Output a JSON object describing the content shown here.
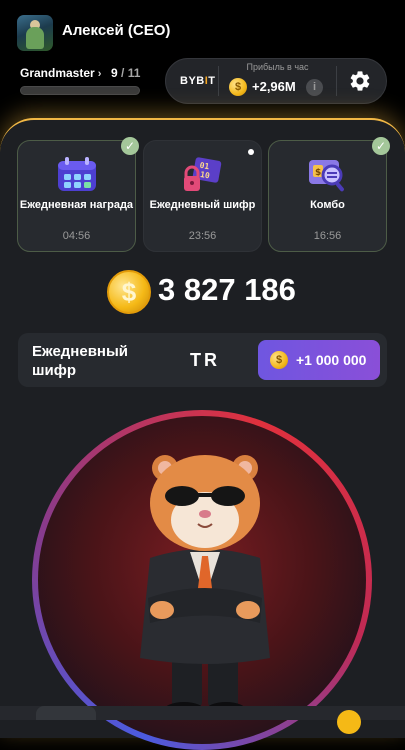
{
  "header": {
    "username": "Алексей (CEO)",
    "rank": "Grandmaster",
    "level_current": "9",
    "level_total": "/ 11",
    "level_progress": 0,
    "exchange": {
      "pre": "BYB",
      "mid": "I",
      "post": "T"
    },
    "profit_label": "Прибыль в час",
    "profit_value": "+2,96M",
    "info_icon": "i"
  },
  "daily_cards": [
    {
      "label": "Ежедневная награда",
      "time": "04:56",
      "completed": true,
      "icon": "calendar-icon"
    },
    {
      "label": "Ежедневный шифр",
      "time": "23:56",
      "completed": false,
      "icon": "cipher-lock-icon"
    },
    {
      "label": "Комбо",
      "time": "16:56",
      "completed": true,
      "icon": "combo-magnifier-icon"
    }
  ],
  "balance": {
    "coin_symbol": "$",
    "value": "3 827 186"
  },
  "cipher": {
    "label": "Ежедневный шифр",
    "code": "TR",
    "reward": "+1 000 000",
    "coin_symbol": "$"
  },
  "colors": {
    "accent_gold": "#f2b845",
    "purple_button": "#7a52de",
    "check_green": "#a4c79a"
  },
  "icons": [
    "settings-gear-icon",
    "info-icon",
    "coin-icon",
    "check-icon"
  ]
}
